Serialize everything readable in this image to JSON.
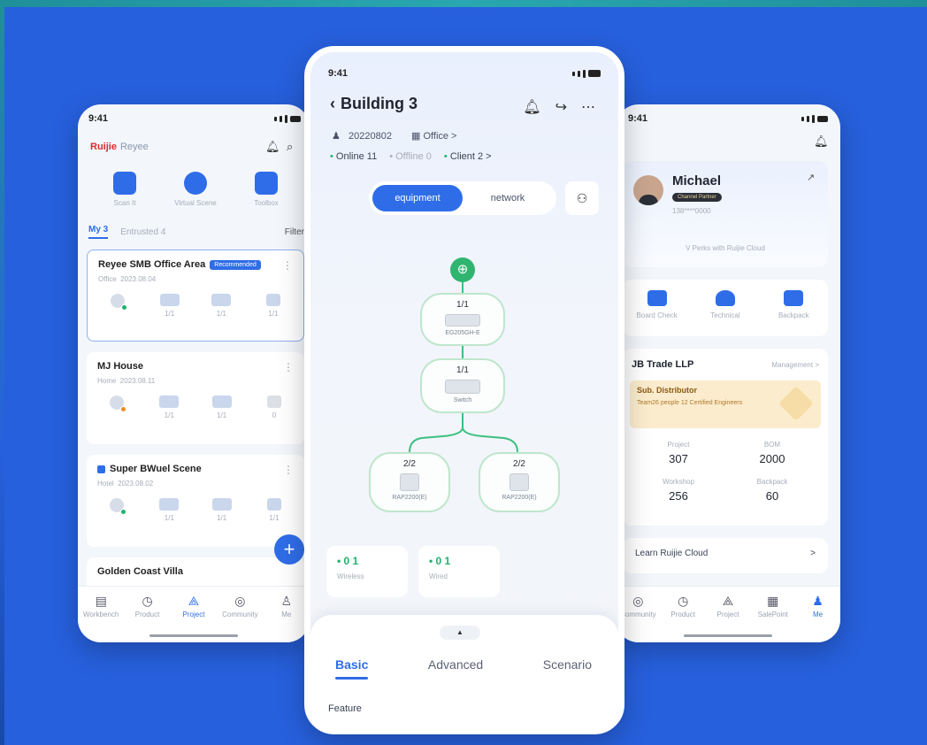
{
  "left_phone": {
    "status": {
      "time": "9:41"
    },
    "brand": {
      "logo": "Ruijie",
      "sub": "Reyee"
    },
    "quick_actions": [
      {
        "label": "Scan It",
        "icon": "scan-icon"
      },
      {
        "label": "Virtual Scene",
        "icon": "cloud-icon"
      },
      {
        "label": "Toolbox",
        "icon": "toolbox-icon"
      }
    ],
    "tabs": {
      "my": "My 3",
      "shared": "Entrusted 4",
      "filter": "Filter"
    },
    "projects": [
      {
        "title": "Reyee SMB Office Area",
        "badge": "Recommended",
        "meta1": "Office",
        "meta2": "2023.08.04",
        "devices": [
          "1/1",
          "1/1",
          "1/1"
        ]
      },
      {
        "title": "MJ House",
        "badge": "",
        "meta1": "Home",
        "meta2": "2023.08.11",
        "devices": [
          "1/1",
          "1/1",
          "0"
        ]
      },
      {
        "title": "Super BWuel Scene",
        "badge": "",
        "meta1": "Hotel",
        "meta2": "2023.08.02",
        "devices": [
          "1/1",
          "1/1",
          "1/1"
        ]
      },
      {
        "title": "Golden Coast Villa",
        "badge": "",
        "meta1": "",
        "meta2": "",
        "devices": []
      }
    ],
    "fab": "+",
    "nav": [
      {
        "label": "Workbench",
        "icon": "▤"
      },
      {
        "label": "Product",
        "icon": "◷"
      },
      {
        "label": "Project",
        "icon": "⟁"
      },
      {
        "label": "Community",
        "icon": "◎"
      },
      {
        "label": "Me",
        "icon": "♙"
      }
    ]
  },
  "center_phone": {
    "status": {
      "time": "9:41"
    },
    "title": "Building 3",
    "meta": {
      "id": "20220802",
      "type": "Office >"
    },
    "counts": {
      "online": "Online 11",
      "offline": "Offline 0",
      "client": "Client 2 >"
    },
    "segments": {
      "equipment": "equipment",
      "network": "network"
    },
    "topology": {
      "gateway": {
        "frac": "1/1",
        "name": "EG205GH-E"
      },
      "switch": {
        "frac": "1/1",
        "name": "Switch"
      },
      "ap_left": {
        "frac": "2/2",
        "name": "RAP2200(E)"
      },
      "ap_right": {
        "frac": "2/2",
        "name": "RAP2200(E)"
      }
    },
    "stats": [
      {
        "value": "0 1",
        "label": "Wireless"
      },
      {
        "value": "0 1",
        "label": "Wired"
      }
    ],
    "sheet": {
      "handle": "▲",
      "tabs": [
        "Basic",
        "Advanced",
        "Scenario"
      ],
      "feature": "Feature"
    }
  },
  "right_phone": {
    "status": {
      "time": "9:41"
    },
    "profile": {
      "name": "Michael",
      "tag": "Channel Partner",
      "phone": "138****0000",
      "note": "V Perks with Ruijie Cloud"
    },
    "quick": [
      {
        "label": "Board Check"
      },
      {
        "label": "Technical"
      },
      {
        "label": "Backpack"
      }
    ],
    "org": {
      "name": "JB Trade LLP",
      "manage": "Management >",
      "badge_title": "Sub. Distributor",
      "badge_sub": "Team26 people 12 Certified Engineers",
      "stats": [
        {
          "label": "Project",
          "value": "307"
        },
        {
          "label": "BOM",
          "value": "2000"
        },
        {
          "label": "Workshop",
          "value": "256"
        },
        {
          "label": "Backpack",
          "value": "60"
        }
      ]
    },
    "cloud": {
      "label": "Learn Ruijie Cloud",
      "chev": ">"
    },
    "nav": [
      {
        "label": "Community",
        "icon": "◎"
      },
      {
        "label": "Product",
        "icon": "◷"
      },
      {
        "label": "Project",
        "icon": "⟁"
      },
      {
        "label": "SalePoint",
        "icon": "▦"
      },
      {
        "label": "Me",
        "icon": "♟"
      }
    ]
  }
}
